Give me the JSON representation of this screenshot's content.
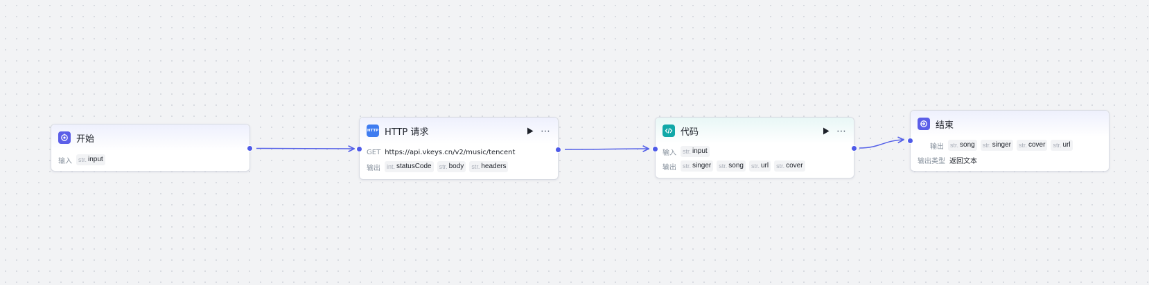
{
  "colors": {
    "edge": "#5561e8",
    "handle": "#4e5ae8",
    "canvas": "#f2f3f5"
  },
  "nodes": {
    "start": {
      "icon": "start-icon",
      "title": "开始",
      "input_label": "输入",
      "inputs": [
        {
          "type": "str.",
          "name": "input"
        }
      ]
    },
    "http": {
      "icon": "http-icon",
      "icon_text": "HTTP",
      "title": "HTTP 请求",
      "method": "GET",
      "url": "https://api.vkeys.cn/v2/music/tencent",
      "output_label": "输出",
      "outputs": [
        {
          "type": "int.",
          "name": "statusCode"
        },
        {
          "type": "str.",
          "name": "body"
        },
        {
          "type": "str.",
          "name": "headers"
        }
      ]
    },
    "code": {
      "icon": "code-icon",
      "title": "代码",
      "input_label": "输入",
      "inputs": [
        {
          "type": "str.",
          "name": "input"
        }
      ],
      "output_label": "输出",
      "outputs": [
        {
          "type": "str.",
          "name": "singer"
        },
        {
          "type": "str.",
          "name": "song"
        },
        {
          "type": "str.",
          "name": "url"
        },
        {
          "type": "str.",
          "name": "cover"
        }
      ]
    },
    "end": {
      "icon": "end-icon",
      "title": "结束",
      "output_label": "输出",
      "outputs": [
        {
          "type": "str.",
          "name": "song"
        },
        {
          "type": "str.",
          "name": "singer"
        },
        {
          "type": "str.",
          "name": "cover"
        },
        {
          "type": "str.",
          "name": "url"
        }
      ],
      "output_type_label": "输出类型",
      "output_type_value": "返回文本"
    }
  }
}
